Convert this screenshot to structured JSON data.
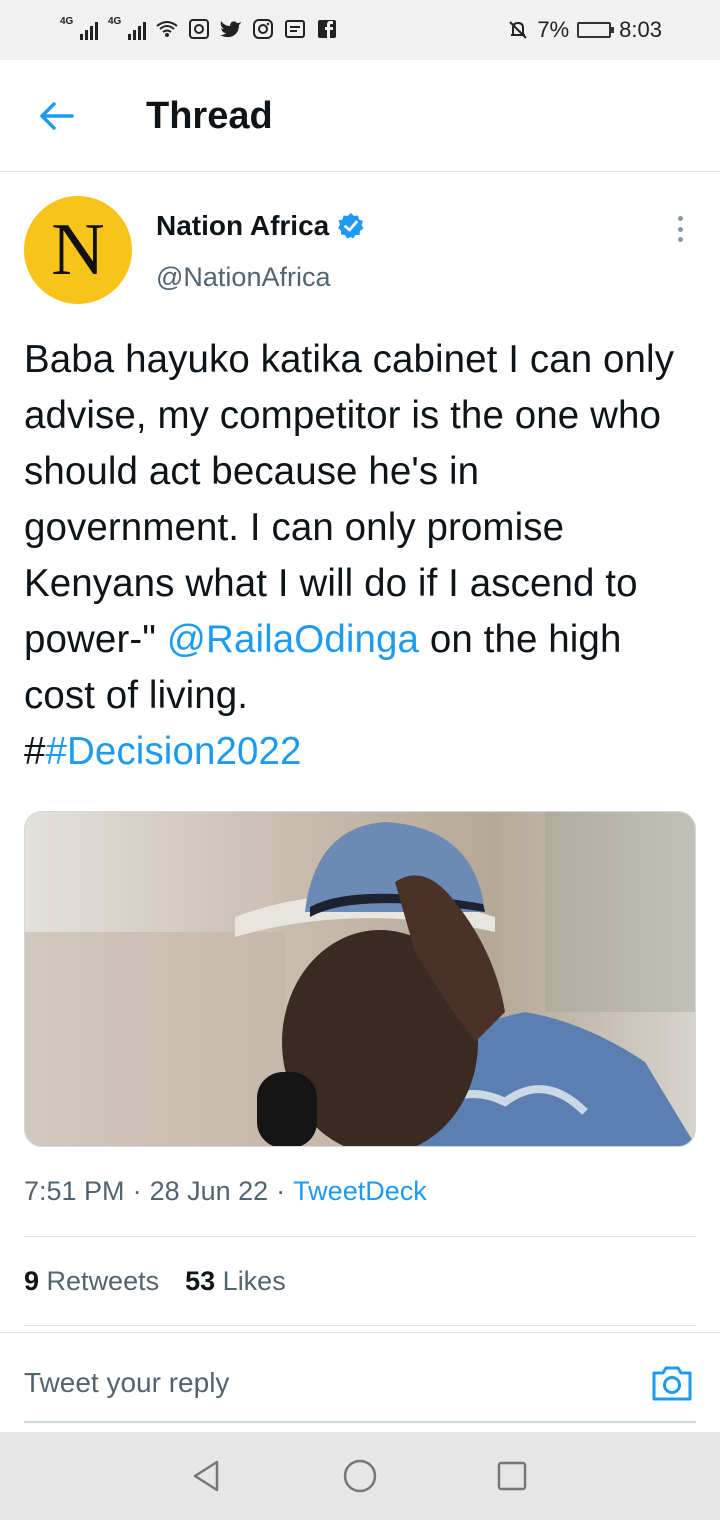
{
  "status_bar": {
    "network1": "4G",
    "network2": "4G",
    "battery": "7%",
    "time": "8:03"
  },
  "header": {
    "title": "Thread"
  },
  "tweet": {
    "author_name": "Nation Africa",
    "handle": "@NationAfrica",
    "avatar_letter": "N",
    "text_part1": "Baba hayuko katika cabinet I can only advise, my competitor is the one who should act because he's in government. I can only promise Kenyans what I will do if I ascend to power-\" ",
    "mention": "@RailaOdinga",
    "text_part2": " on the high cost of living.",
    "hash_prefix": "#",
    "hashtag": "#Decision2022",
    "time": "7:51 PM",
    "date": "28 Jun 22",
    "source": "TweetDeck",
    "retweets_count": "9",
    "retweets_label": "Retweets",
    "likes_count": "53",
    "likes_label": "Likes"
  },
  "reply": {
    "placeholder": "Tweet your reply"
  },
  "colors": {
    "accent": "#1d9bf0",
    "avatar_bg": "#f8c31a"
  }
}
